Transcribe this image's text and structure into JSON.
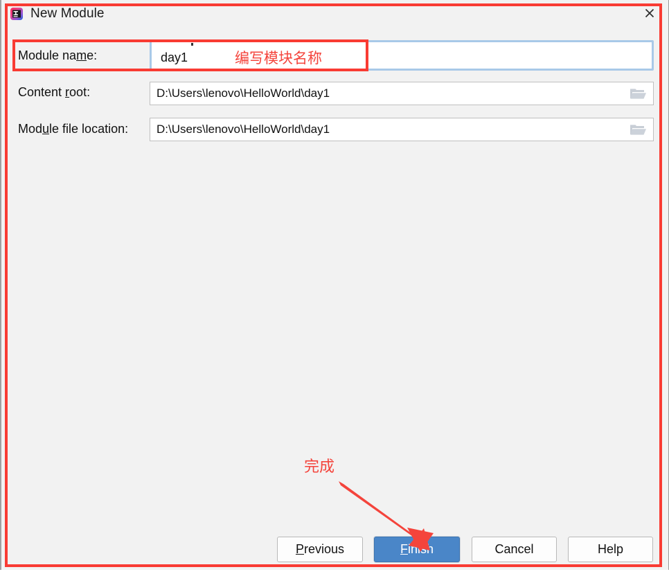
{
  "window": {
    "title": "New Module",
    "app_icon": "intellij-idea-icon",
    "close_icon": "close-icon",
    "background_color": "#f2f2f2"
  },
  "annotation": {
    "color": "#f93b33",
    "module_name_note": "编写模块名称",
    "finish_note": "完成"
  },
  "form": {
    "rows": [
      {
        "label_prefix": "Module na",
        "label_mnemonic": "m",
        "label_suffix": "e:",
        "value": "day1",
        "focused": true
      },
      {
        "label_prefix": "Content ",
        "label_mnemonic": "r",
        "label_suffix": "oot:",
        "value": "D:\\Users\\lenovo\\HelloWorld\\day1",
        "browse_icon": "folder-icon"
      },
      {
        "label_prefix": "Mod",
        "label_mnemonic": "u",
        "label_suffix": "le file location:",
        "value": "D:\\Users\\lenovo\\HelloWorld\\day1",
        "browse_icon": "folder-icon"
      }
    ]
  },
  "buttons": {
    "previous": {
      "prefix": "",
      "mnemonic": "P",
      "suffix": "revious"
    },
    "finish": {
      "prefix": "",
      "mnemonic": "F",
      "suffix": "inish",
      "primary": true,
      "accent_color": "#4a86c8"
    },
    "cancel": {
      "label": "Cancel"
    },
    "help": {
      "label": "Help"
    }
  }
}
